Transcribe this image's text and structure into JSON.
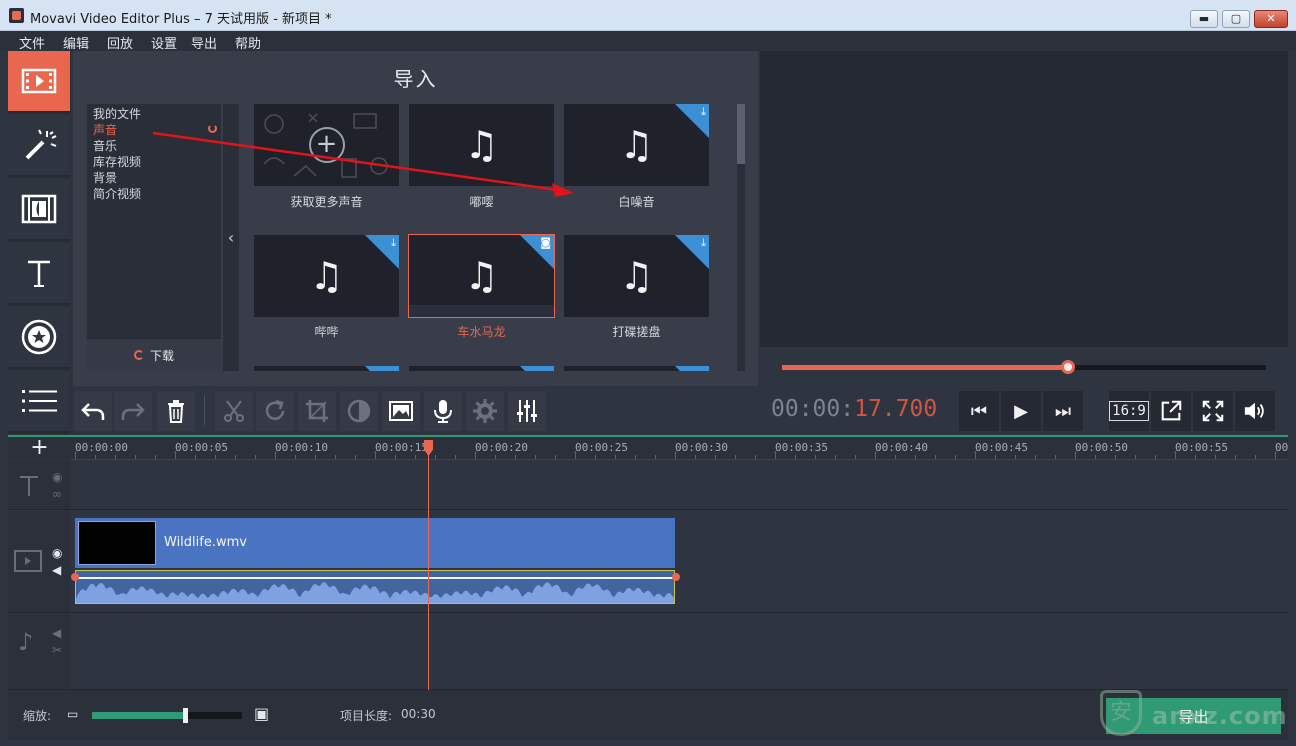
{
  "window": {
    "title": "Movavi Video Editor Plus – 7 天试用版 - 新项目 *",
    "minimize": "▬",
    "maximize": "▢",
    "close": "✕"
  },
  "menu": [
    "文件",
    "编辑",
    "回放",
    "设置",
    "导出",
    "帮助"
  ],
  "rail": [
    "film-import-icon",
    "magic-wand-icon",
    "transitions-icon",
    "titles-icon",
    "stickers-icon",
    "list-icon"
  ],
  "import": {
    "title": "导入",
    "categories": [
      "我的文件",
      "声音",
      "音乐",
      "库存视频",
      "背景",
      "简介视频"
    ],
    "selected_category": 1,
    "download_label": "下载",
    "collapse_glyph": "‹",
    "tiles": [
      {
        "label": "获取更多声音",
        "type": "get-more"
      },
      {
        "label": "嘟嘤",
        "type": "sound"
      },
      {
        "label": "白噪音",
        "type": "sound-download"
      },
      {
        "label": "哔哔",
        "type": "sound-download"
      },
      {
        "label": "车水马龙",
        "type": "sound-playing"
      },
      {
        "label": "打碟搓盘",
        "type": "sound-download"
      }
    ]
  },
  "preview": {
    "progress": 0.59
  },
  "toolbar": {
    "timecode_gray": "00:00:",
    "timecode_red": "17.700",
    "aspect": "16:9"
  },
  "ruler": [
    "00:00:00",
    "00:00:05",
    "00:00:10",
    "00:00:15",
    "00:00:20",
    "00:00:25",
    "00:00:30",
    "00:00:35",
    "00:00:40",
    "00:00:45",
    "00:00:50",
    "00:00:55",
    "00"
  ],
  "timeline": {
    "add_glyph": "+",
    "clip_name": "Wildlife.wmv"
  },
  "bottom": {
    "zoom_label": "缩放:",
    "zoom_level": 0.62,
    "project_length_label": "项目长度:",
    "project_length": "00:30",
    "export_label": "导出"
  },
  "watermark": {
    "shield": "安",
    "text": "anxz.com"
  },
  "colors": {
    "accent": "#e9664f",
    "export_green": "#2f9a74",
    "clip_blue": "#4a74c2",
    "download_corner": "#3d8fd6"
  }
}
